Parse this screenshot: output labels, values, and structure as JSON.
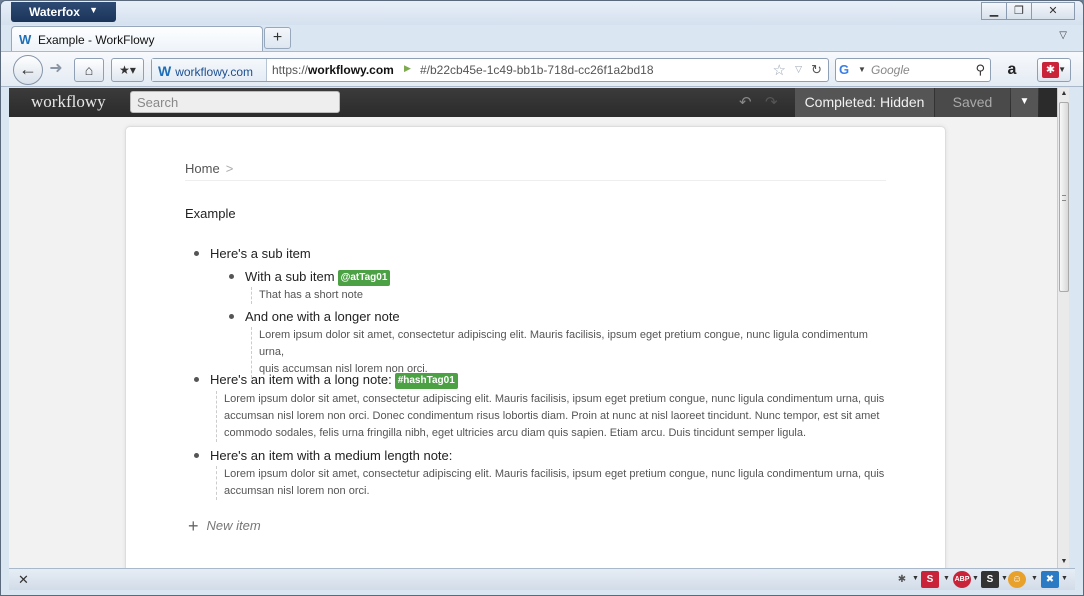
{
  "browser": {
    "app_name": "Waterfox",
    "tab_title": "Example - WorkFlowy",
    "identity": "workflowy.com",
    "url_prefix": "https://",
    "url_domain": "workflowy.com",
    "url_hash": "#/b22cb45e-1c49-bb1b-718d-cc26f1a2bd18",
    "search_placeholder": "Google"
  },
  "workflowy": {
    "logo": "workflowy",
    "search_placeholder": "Search",
    "completed_label": "Completed: Hidden",
    "saved_label": "Saved",
    "breadcrumb_home": "Home",
    "breadcrumb_sep": ">",
    "page_title": "Example",
    "items": [
      {
        "text": "Here's a sub item"
      },
      {
        "text": "With a sub item",
        "tag": "@atTag01",
        "note": "That has a short note"
      },
      {
        "text": "And one with a longer note",
        "note_lines": [
          "Lorem ipsum dolor sit amet, consectetur adipiscing elit. Mauris facilisis, ipsum eget pretium congue, nunc ligula condimentum urna,",
          "quis accumsan nisl lorem non orci."
        ]
      },
      {
        "text": "Here's an item with a long note:",
        "tag": "#hashTag01",
        "note_lines": [
          "Lorem ipsum dolor sit amet, consectetur adipiscing elit. Mauris facilisis, ipsum eget pretium congue, nunc ligula condimentum urna, quis",
          "accumsan nisl lorem non orci. Donec condimentum risus lobortis diam. Proin at nunc at nisl laoreet tincidunt. Nunc tempor, est sit amet",
          "commodo sodales, felis urna fringilla nibh, eget ultricies arcu diam quis sapien. Etiam arcu. Duis tincidunt semper ligula."
        ]
      },
      {
        "text": "Here's an item with a medium length note:",
        "note_lines": [
          "Lorem ipsum dolor sit amet, consectetur adipiscing elit. Mauris facilisis, ipsum eget pretium congue, nunc ligula condimentum urna, quis",
          "accumsan nisl lorem non orci."
        ]
      }
    ],
    "new_item": "New item"
  },
  "colors": {
    "tag_green": "#4ca145",
    "header_dark": "#333333"
  }
}
